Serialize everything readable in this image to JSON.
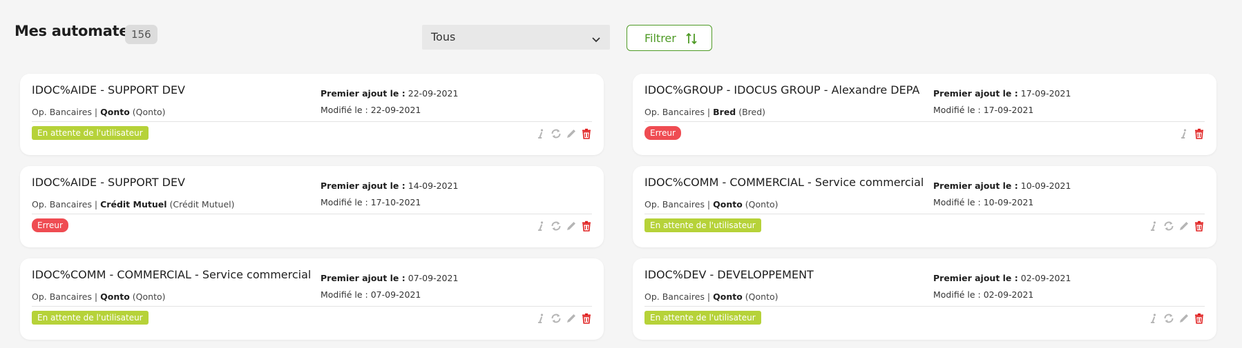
{
  "header": {
    "title": "Mes automates",
    "count": "156",
    "filter_select": {
      "selected": "Tous"
    },
    "filter_button": {
      "label": "Filtrer"
    }
  },
  "labels": {
    "first_added": "Premier ajout le :",
    "modified": "Modifié le :"
  },
  "colors": {
    "accent_green": "#4e9a25",
    "status_pending": "#b6d239",
    "status_error": "#ef4c52",
    "delete_red": "#e02020",
    "icon_gray": "#b5b5b5"
  },
  "cards": [
    {
      "name": "IDOC%AIDE - SUPPORT DEV",
      "category": "Op. Bancaires |",
      "bank": "Qonto",
      "bank_detail": "(Qonto)",
      "first_added": "22-09-2021",
      "modified": "22-09-2021",
      "status": "En attente de l'utilisateur",
      "actions": [
        "info-icon",
        "sync-icon",
        "edit-icon",
        "delete-icon"
      ]
    },
    {
      "name": "IDOC%GROUP - IDOCUS GROUP - Alexandre DEPA",
      "category": "Op. Bancaires |",
      "bank": "Bred",
      "bank_detail": "(Bred)",
      "first_added": "17-09-2021",
      "modified": "17-09-2021",
      "status": "Erreur",
      "actions": [
        "info-icon",
        "delete-icon"
      ]
    },
    {
      "name": "IDOC%AIDE - SUPPORT DEV",
      "category": "Op. Bancaires |",
      "bank": "Crédit Mutuel",
      "bank_detail": "(Crédit Mutuel)",
      "first_added": "14-09-2021",
      "modified": "17-10-2021",
      "status": "Erreur",
      "actions": [
        "info-icon",
        "sync-icon",
        "edit-icon",
        "delete-icon"
      ]
    },
    {
      "name": "IDOC%COMM - COMMERCIAL - Service commercial",
      "category": "Op. Bancaires |",
      "bank": "Qonto",
      "bank_detail": "(Qonto)",
      "first_added": "10-09-2021",
      "modified": "10-09-2021",
      "status": "En attente de l'utilisateur",
      "actions": [
        "info-icon",
        "sync-icon",
        "edit-icon",
        "delete-icon"
      ]
    },
    {
      "name": "IDOC%COMM - COMMERCIAL - Service commercial",
      "category": "Op. Bancaires |",
      "bank": "Qonto",
      "bank_detail": "(Qonto)",
      "first_added": "07-09-2021",
      "modified": "07-09-2021",
      "status": "En attente de l'utilisateur",
      "actions": [
        "info-icon",
        "sync-icon",
        "edit-icon",
        "delete-icon"
      ]
    },
    {
      "name": "IDOC%DEV - DEVELOPPEMENT",
      "category": "Op. Bancaires |",
      "bank": "Qonto",
      "bank_detail": "(Qonto)",
      "first_added": "02-09-2021",
      "modified": "02-09-2021",
      "status": "En attente de l'utilisateur",
      "actions": [
        "info-icon",
        "sync-icon",
        "edit-icon",
        "delete-icon"
      ]
    }
  ]
}
